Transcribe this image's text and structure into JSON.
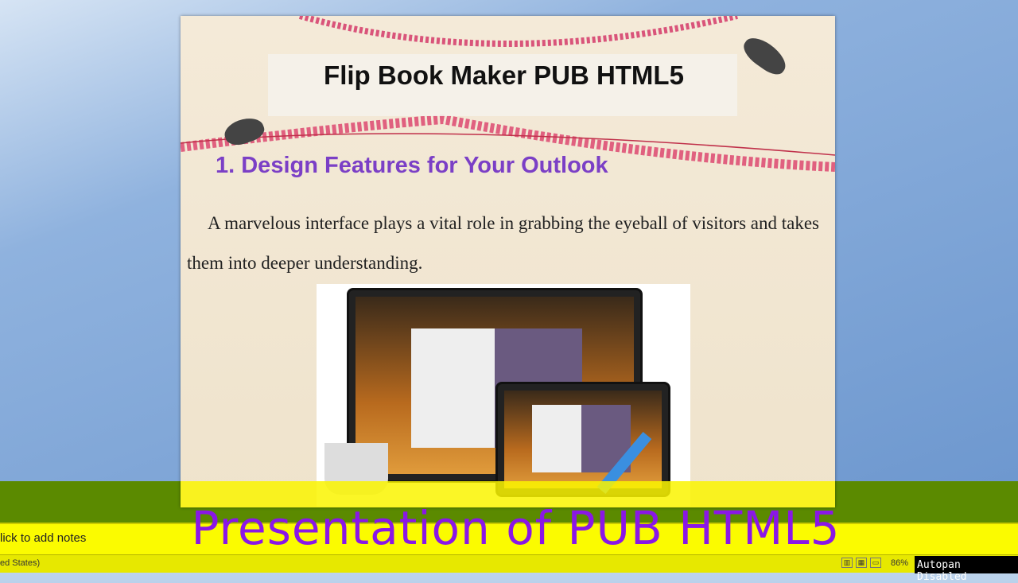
{
  "slide": {
    "title": "Flip Book Maker PUB HTML5",
    "heading": "1. Design Features for Your Outlook",
    "body": "A marvelous interface plays a vital role in grabbing the eyeball of visitors and takes them into deeper understanding."
  },
  "caption": "Presentation of PUB HTML5",
  "notes": {
    "placeholder": "lick to add notes"
  },
  "status": {
    "language": "ed States)",
    "zoom": "86%",
    "autopan": "Autopan Disabled"
  }
}
